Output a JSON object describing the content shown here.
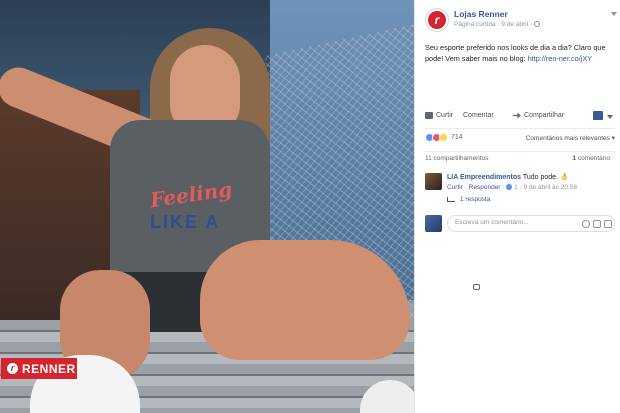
{
  "brand": {
    "badge_text": "RENNER",
    "accent": "#d4252f"
  },
  "post": {
    "page_name": "Lojas Renner",
    "meta": "Página curtida · 9 de abril ·",
    "text": "Seu esporte preferido nos looks de dia a dia? Claro que pode! Vem saber mais no blog: ",
    "link": "http://ren-ner.co/jXY",
    "actions": {
      "like": "Curtir",
      "comment": "Comentar",
      "share": "Compartilhar"
    },
    "reactions_count": "714",
    "relevance": "Comentários mais relevantes",
    "shares": "11 compartilhamentos",
    "comments_count_num": "1",
    "comments_count_label": "comentário"
  },
  "comment": {
    "author": "LIA Empreendimentos",
    "text": "Tudo pode. 👌",
    "like": "Curtir",
    "reply": "Responder",
    "likes": "1",
    "date": "9 de abril às 20:58",
    "replies": "1 resposta"
  },
  "composer": {
    "placeholder": "Escreva um comentário..."
  },
  "photo": {
    "shirt_text": "Feeling",
    "shirt_text2": "LIKE A"
  }
}
